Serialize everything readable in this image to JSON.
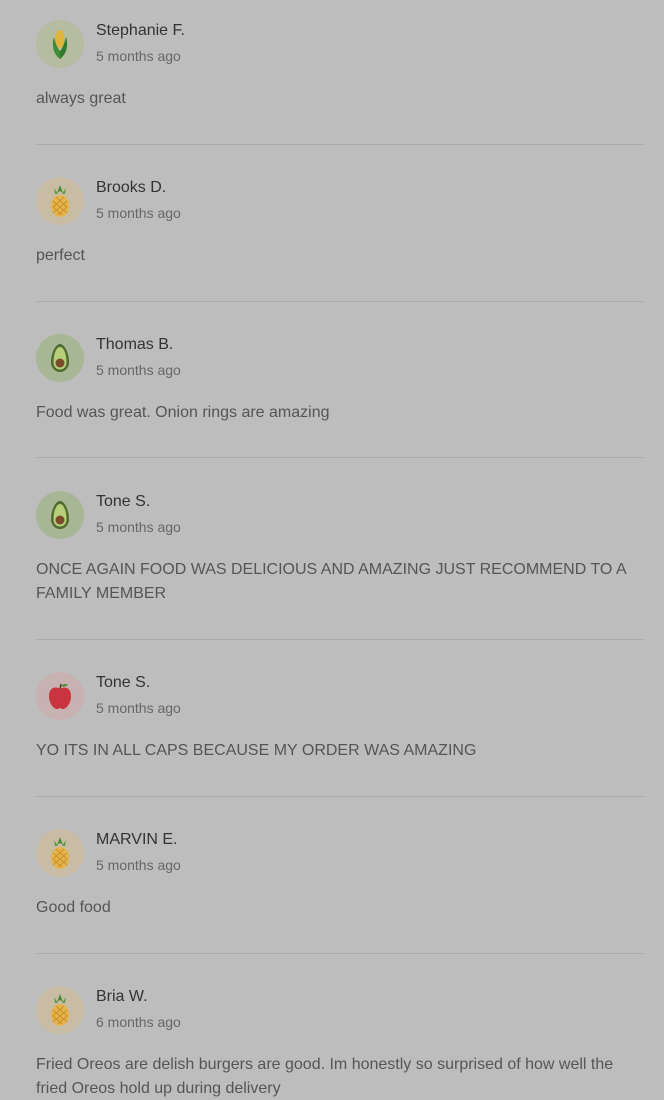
{
  "reviews": [
    {
      "name": "Stephanie F.",
      "time": "5 months ago",
      "text": "always great",
      "avatar_icon": "corn-icon"
    },
    {
      "name": "Brooks D.",
      "time": "5 months ago",
      "text": "perfect",
      "avatar_icon": "pineapple-icon"
    },
    {
      "name": "Thomas B.",
      "time": "5 months ago",
      "text": "Food was great. Onion rings are amazing",
      "avatar_icon": "avocado-icon"
    },
    {
      "name": "Tone S.",
      "time": "5 months ago",
      "text": "ONCE AGAIN FOOD WAS DELICIOUS AND AMAZING JUST RECOMMEND TO A FAMILY MEMBER",
      "avatar_icon": "avocado-icon"
    },
    {
      "name": "Tone S.",
      "time": "5 months ago",
      "text": "YO ITS IN ALL CAPS BECAUSE MY ORDER WAS AMAZING",
      "avatar_icon": "apple-icon"
    },
    {
      "name": "MARVIN E.",
      "time": "5 months ago",
      "text": "Good food",
      "avatar_icon": "pineapple-icon"
    },
    {
      "name": "Bria W.",
      "time": "6 months ago",
      "text": "Fried Oreos are delish burgers are good. Im honestly so surprised of how well the fried Oreos hold up during delivery",
      "avatar_icon": "pineapple-icon"
    }
  ],
  "colors": {
    "background": "#bdbdbd",
    "divider": "#aaaaaa",
    "name_text": "#333333",
    "secondary_text": "#666666"
  }
}
